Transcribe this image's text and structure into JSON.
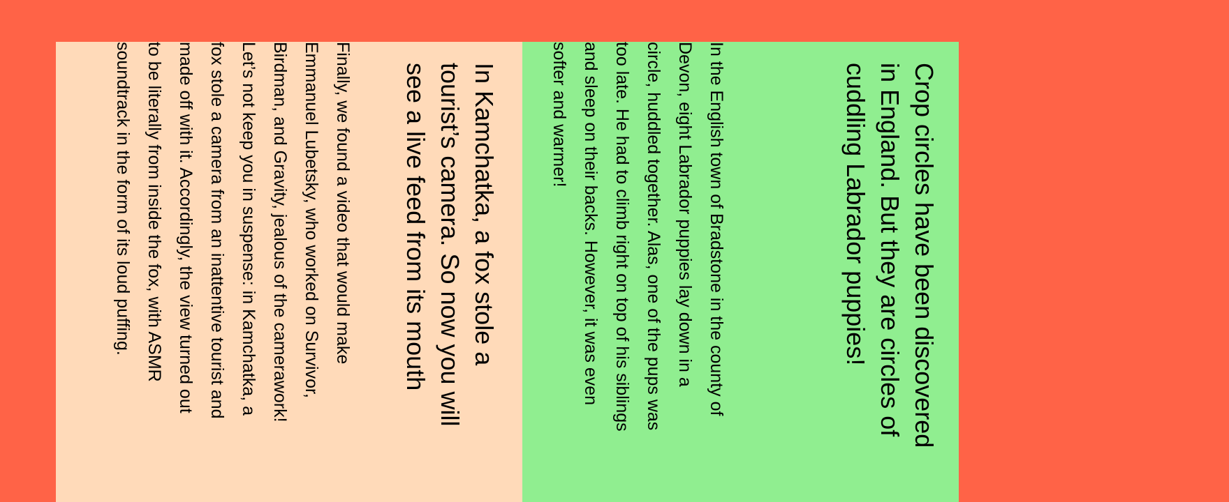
{
  "articles": [
    {
      "headline": "In Kamchatka, a fox stole a tourist’s camera. So now you will see a live feed from its mouth",
      "body": "Finally, we found a video that would make Emmanuel Lubetsky, who worked on Survivor, Birdman, and Gravity, jealous of the camerawork! Let’s not keep you in suspense: in Kamchatka, a fox stole a camera from an inattentive tourist and made off with it. Accordingly, the view turned out to be literally from inside the fox, with ASMR soundtrack in the form of its loud puffing.",
      "background": "#ffdab9"
    },
    {
      "headline": "Crop circles have been discovered in England. But they are circles of cuddling Labrador puppies!",
      "body": "In the English town of Bradstone in the county of Devon, eight Labrador puppies lay down in a circle, huddled together. Alas, one of the pups was too late. He had to climb right on top of his siblings and sleep on their backs. However, it was even softer and warmer!",
      "background": "#90ee90"
    }
  ],
  "page_background": "#ff6347"
}
